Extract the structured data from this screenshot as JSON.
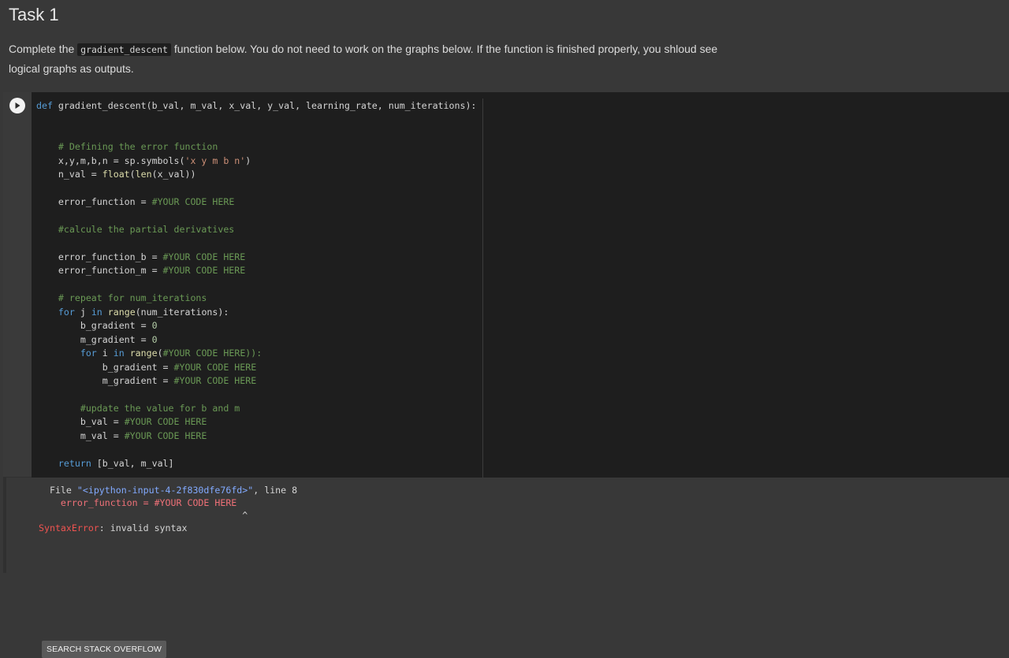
{
  "task": {
    "title": "Task 1",
    "desc_before": "Complete the ",
    "desc_code": "gradient_descent",
    "desc_after": " function below. You do not need to work on the graphs below. If the function is finished properly, you shloud see logical graphs as outputs."
  },
  "code_cell": {
    "run_icon": "play-circle-icon",
    "lines": [
      "def gradient_descent(b_val, m_val, x_val, y_val, learning_rate, num_iterations):",
      "",
      "",
      "    # Defining the error function",
      "    x,y,m,b,n = sp.symbols('x y m b n')",
      "    n_val = float(len(x_val))",
      "",
      "    error_function = #YOUR CODE HERE",
      "",
      "    #calcule the partial derivatives",
      "",
      "    error_function_b = #YOUR CODE HERE",
      "    error_function_m = #YOUR CODE HERE",
      "",
      "    # repeat for num_iterations",
      "    for j in range(num_iterations):",
      "        b_gradient = 0",
      "        m_gradient = 0",
      "        for i in range(#YOUR CODE HERE)):",
      "            b_gradient = #YOUR CODE HERE",
      "            m_gradient = #YOUR CODE HERE",
      "",
      "        #update the value for b and m",
      "        b_val = #YOUR CODE HERE",
      "        m_val = #YOUR CODE HERE",
      "",
      "    return [b_val, m_val]"
    ]
  },
  "output": {
    "file_prefix": "  File ",
    "file_name": "\"<ipython-input-4-2f830dfe76fd>\"",
    "line_info": ", line 8",
    "error_source": "    error_function = #YOUR CODE HERE",
    "caret": "                                     ^",
    "error_type": "SyntaxError",
    "error_message": ": invalid syntax",
    "search_button": "SEARCH STACK OVERFLOW"
  },
  "colors": {
    "background": "#383838",
    "editor": "#1e1e1e",
    "keyword": "#569cd6",
    "comment": "#6a9955",
    "string": "#ce9178",
    "error": "#ef5350"
  }
}
